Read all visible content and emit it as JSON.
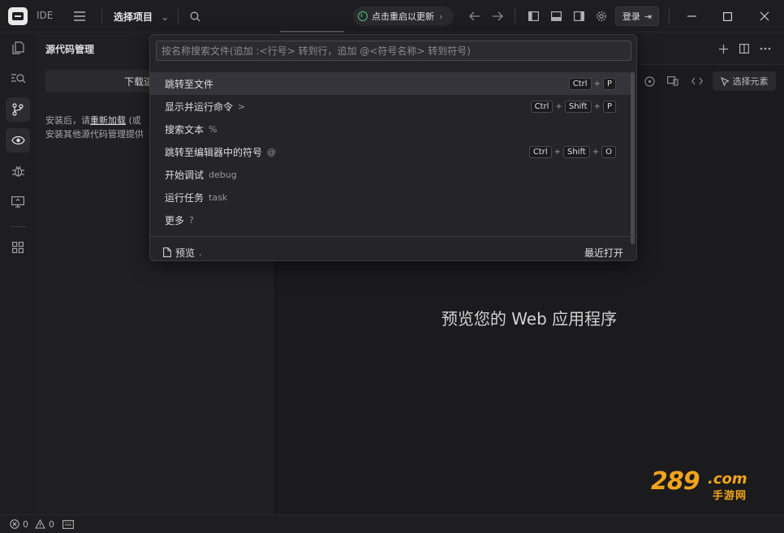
{
  "titlebar": {
    "app_label": "IDE",
    "project_label": "选择项目",
    "update_label": "点击重启以更新",
    "login_label": "登录"
  },
  "sidebar": {
    "title": "源代码管理",
    "download_button": "下载适用于 W",
    "info_line1_prefix": "安装后，请",
    "info_line1_link": "重新加载",
    "info_line1_suffix": " (或",
    "info_line2": "安装其他源代码管理提供"
  },
  "main": {
    "select_element_label": "选择元素",
    "preview_title": "预览您的 Web 应用程序"
  },
  "watermark": {
    "number": "289",
    "domain": ".com",
    "sub": "手游网"
  },
  "palette": {
    "search_placeholder": "按名称搜索文件(追加 :<行号> 转到行，追加 @<符号名称> 转到符号)",
    "items": [
      {
        "label": "跳转至文件",
        "hint": "",
        "keys": [
          "Ctrl",
          "P"
        ]
      },
      {
        "label": "显示并运行命令",
        "hint": ">",
        "keys": [
          "Ctrl",
          "Shift",
          "P"
        ]
      },
      {
        "label": "搜索文本",
        "hint": "%",
        "keys": []
      },
      {
        "label": "跳转至编辑器中的符号",
        "hint": "@",
        "keys": [
          "Ctrl",
          "Shift",
          "O"
        ]
      },
      {
        "label": "开始调试",
        "hint": "debug",
        "keys": []
      },
      {
        "label": "运行任务",
        "hint": "task",
        "keys": []
      },
      {
        "label": "更多",
        "hint": "?",
        "keys": []
      }
    ],
    "footer_label": "预览",
    "footer_hint": ".",
    "footer_recent": "最近打开",
    "plus_sign": "+"
  },
  "statusbar": {
    "errors": "0",
    "warnings": "0"
  },
  "icons": {
    "accent_green": "#4cc37a",
    "watermark_orange": "#f3a41a"
  }
}
